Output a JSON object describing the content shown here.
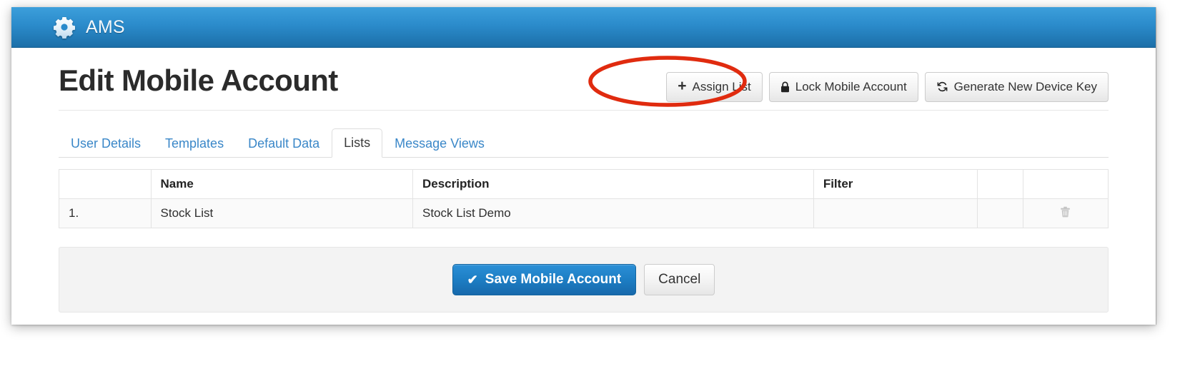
{
  "navbar": {
    "brand": "AMS",
    "brand_icon": "gear-icon",
    "background_color": "#2b8bcb"
  },
  "page": {
    "title": "Edit Mobile Account"
  },
  "header_actions": [
    {
      "label": "Assign List",
      "icon": "plus-icon"
    },
    {
      "label": "Lock Mobile Account",
      "icon": "lock-icon"
    },
    {
      "label": "Generate New Device Key",
      "icon": "refresh-icon"
    }
  ],
  "tabs": [
    {
      "label": "User Details",
      "active": false
    },
    {
      "label": "Templates",
      "active": false
    },
    {
      "label": "Default Data",
      "active": false
    },
    {
      "label": "Lists",
      "active": true
    },
    {
      "label": "Message Views",
      "active": false
    }
  ],
  "table": {
    "columns": [
      "",
      "Name",
      "Description",
      "Filter",
      "",
      ""
    ],
    "rows": [
      {
        "index": "1.",
        "name": "Stock List",
        "description": "Stock List Demo",
        "filter": "",
        "spacer": "",
        "action_icon": "trash-icon"
      }
    ]
  },
  "footer": {
    "save_label": "Save Mobile Account",
    "save_icon": "check-icon",
    "cancel_label": "Cancel"
  },
  "annotation": {
    "type": "ellipse",
    "color": "#e02b0f",
    "target": "Assign List"
  }
}
